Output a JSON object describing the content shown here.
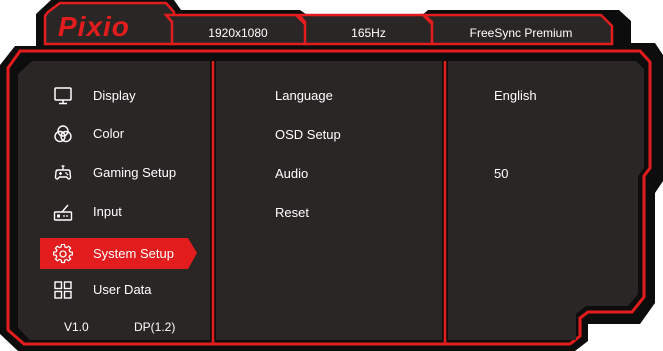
{
  "brand": {
    "name": "Pixio"
  },
  "tabs": [
    {
      "label": "1920x1080"
    },
    {
      "label": "165Hz"
    },
    {
      "label": "FreeSync Premium"
    }
  ],
  "sidebar": {
    "items": [
      {
        "label": "Display",
        "icon": "monitor-icon"
      },
      {
        "label": "Color",
        "icon": "color-circles-icon"
      },
      {
        "label": "Gaming Setup",
        "icon": "gamepad-icon"
      },
      {
        "label": "Input",
        "icon": "input-port-icon"
      },
      {
        "label": "System Setup",
        "icon": "gear-icon",
        "selected": true
      },
      {
        "label": "User Data",
        "icon": "grid-icon"
      }
    ],
    "footer": {
      "version": "V1.0",
      "input_source": "DP(1.2)"
    }
  },
  "submenu": {
    "items": [
      {
        "label": "Language"
      },
      {
        "label": "OSD Setup"
      },
      {
        "label": "Audio"
      },
      {
        "label": "Reset"
      }
    ]
  },
  "values": {
    "language": "English",
    "audio": "50"
  },
  "colors": {
    "accent": "#e31d1d",
    "panel": "#2b2626",
    "frame": "#0d0d0d",
    "text": "#ffffff"
  }
}
